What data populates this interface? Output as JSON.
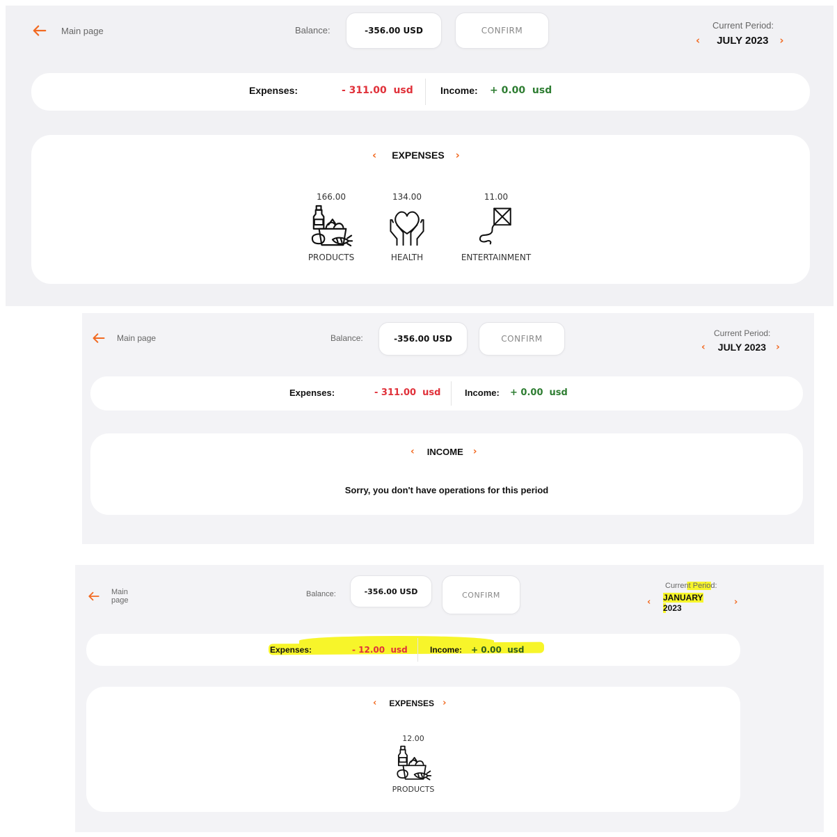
{
  "colors": {
    "accent": "#f26a21",
    "expense": "#e0313a",
    "income": "#2e7d32",
    "highlight": "#f7f52a",
    "background": "#f1f1f4"
  },
  "icons": {
    "back": "arrow-left-icon",
    "prev": "chevron-left-icon",
    "next": "chevron-right-icon"
  },
  "panels": [
    {
      "header": {
        "back_label": "Main page",
        "balance_label": "Balance:",
        "balance_value": "-356.00 USD",
        "confirm_label": "CONFIRM",
        "period_label": "Current Period:",
        "period_value": "JULY 2023"
      },
      "summary": {
        "expenses_label": "Expenses:",
        "expenses_value": "- 311.00  usd",
        "income_label": "Income:",
        "income_value": "+ 0.00  usd"
      },
      "section": {
        "title": "EXPENSES",
        "categories": [
          {
            "value": "166.00",
            "label": "PRODUCTS",
            "icon": "groceries-bag-icon"
          },
          {
            "value": "134.00",
            "label": "HEALTH",
            "icon": "heart-hands-icon"
          },
          {
            "value": "11.00",
            "label": "ENTERTAINMENT",
            "icon": "kite-icon"
          }
        ]
      }
    },
    {
      "header": {
        "back_label": "Main page",
        "balance_label": "Balance:",
        "balance_value": "-356.00 USD",
        "confirm_label": "CONFIRM",
        "period_label": "Current Period:",
        "period_value": "JULY 2023"
      },
      "summary": {
        "expenses_label": "Expenses:",
        "expenses_value": "- 311.00  usd",
        "income_label": "Income:",
        "income_value": "+ 0.00  usd"
      },
      "section": {
        "title": "INCOME",
        "empty_message": "Sorry, you don't have operations for this period"
      }
    },
    {
      "header": {
        "back_label": "Main page",
        "balance_label": "Balance:",
        "balance_value": "-356.00 USD",
        "confirm_label": "CONFIRM",
        "period_label": "Current Period:",
        "period_month": "JANUARY",
        "period_year": "2023"
      },
      "summary": {
        "expenses_label": "Expenses:",
        "expenses_value": "- 12.00  usd",
        "income_label": "Income:",
        "income_value": "+ 0.00  usd"
      },
      "section": {
        "title": "EXPENSES",
        "categories": [
          {
            "value": "12.00",
            "label": "PRODUCTS",
            "icon": "groceries-bag-icon"
          }
        ]
      }
    }
  ]
}
